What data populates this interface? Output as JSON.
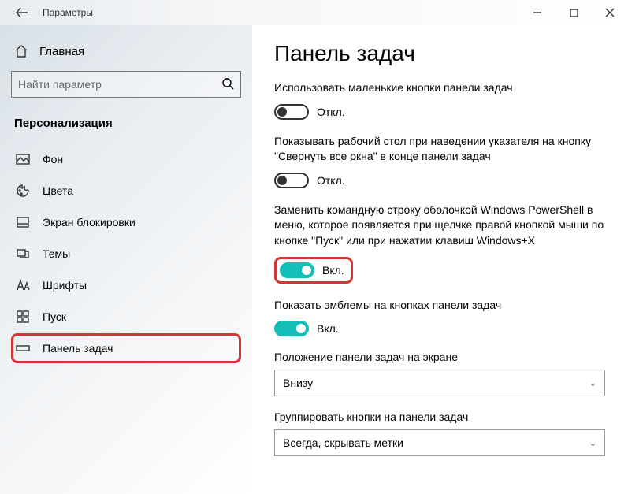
{
  "titlebar": {
    "title": "Параметры"
  },
  "sidebar": {
    "home": "Главная",
    "search_placeholder": "Найти параметр",
    "category": "Персонализация",
    "items": [
      {
        "label": "Фон"
      },
      {
        "label": "Цвета"
      },
      {
        "label": "Экран блокировки"
      },
      {
        "label": "Темы"
      },
      {
        "label": "Шрифты"
      },
      {
        "label": "Пуск"
      },
      {
        "label": "Панель задач"
      }
    ]
  },
  "main": {
    "heading": "Панель задач",
    "settings": [
      {
        "label": "Использовать маленькие кнопки панели задач",
        "on": false,
        "state": "Откл."
      },
      {
        "label": "Показывать рабочий стол при наведении указателя на кнопку \"Свернуть все окна\" в конце панели задач",
        "on": false,
        "state": "Откл."
      },
      {
        "label": "Заменить командную строку оболочкой Windows PowerShell в меню, которое появляется при щелчке правой кнопкой мыши по кнопке \"Пуск\" или при нажатии клавиш Windows+X",
        "on": true,
        "state": "Вкл.",
        "highlight": true
      },
      {
        "label": "Показать эмблемы на кнопках панели задач",
        "on": true,
        "state": "Вкл."
      }
    ],
    "selects": [
      {
        "label": "Положение панели задач на экране",
        "value": "Внизу"
      },
      {
        "label": "Группировать кнопки на панели задач",
        "value": "Всегда, скрывать метки"
      }
    ]
  }
}
